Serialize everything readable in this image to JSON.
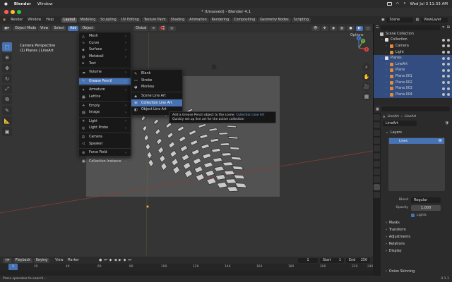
{
  "macos": {
    "app": "Blender",
    "menu": [
      "Window"
    ],
    "datetime": "Wed Jul 3  11:33 AM"
  },
  "window": {
    "title": "* (Unsaved) - Blender 4.1"
  },
  "topbar": {
    "menus": [
      "File",
      "Edit",
      "Render",
      "Window",
      "Help"
    ],
    "workspaces": [
      "Layout",
      "Modeling",
      "Sculpting",
      "UV Editing",
      "Texture Paint",
      "Shading",
      "Animation",
      "Rendering",
      "Compositing",
      "Geometry Nodes",
      "Scripting"
    ],
    "active_workspace": "Layout",
    "scene": "Scene",
    "view_layer": "ViewLayer"
  },
  "viewport": {
    "mode": "Object Mode",
    "menus": [
      "View",
      "Select",
      "Add",
      "Object"
    ],
    "active_menu": "Add",
    "orientation": "Global",
    "options": "Options",
    "overlay_line1": "Camera Perspective",
    "overlay_line2": "(1) Planes | LineArt",
    "axis_labels": {
      "x": "X",
      "y": "Y",
      "z": "Z"
    }
  },
  "add_menu": {
    "items": [
      {
        "label": "Mesh",
        "icon": "mesh-icon",
        "sub": true
      },
      {
        "label": "Curve",
        "icon": "curve-icon",
        "sub": true
      },
      {
        "label": "Surface",
        "icon": "surface-icon",
        "sub": true
      },
      {
        "label": "Metaball",
        "icon": "metaball-icon",
        "sub": true
      },
      {
        "label": "Text",
        "icon": "text-icon",
        "sub": false
      },
      {
        "label": "Volume",
        "icon": "volume-icon",
        "sub": true
      },
      {
        "label": "Grease Pencil",
        "icon": "grease-pencil-icon",
        "sub": true
      },
      {
        "label": "Armature",
        "icon": "armature-icon",
        "sub": true
      },
      {
        "label": "Lattice",
        "icon": "lattice-icon",
        "sub": false
      },
      {
        "label": "Empty",
        "icon": "empty-icon",
        "sub": true
      },
      {
        "label": "Image",
        "icon": "image-icon",
        "sub": true
      },
      {
        "label": "Light",
        "icon": "light-icon",
        "sub": true
      },
      {
        "label": "Light Probe",
        "icon": "light-probe-icon",
        "sub": true
      },
      {
        "label": "Camera",
        "icon": "camera-icon",
        "sub": false
      },
      {
        "label": "Speaker",
        "icon": "speaker-icon",
        "sub": false
      },
      {
        "label": "Force Field",
        "icon": "force-field-icon",
        "sub": true
      },
      {
        "label": "Collection Instance",
        "icon": "collection-instance-icon",
        "sub": true
      }
    ],
    "highlighted": "Grease Pencil"
  },
  "gp_submenu": {
    "items": [
      "Blank",
      "Stroke",
      "Monkey",
      "Scene Line Art",
      "Collection Line Art",
      "Object Line Art"
    ],
    "highlighted": "Collection Line Art"
  },
  "tooltip": {
    "line1_prefix": "Add a Grease Pencil object to the scene:",
    "line1_value": "Collection Line Art",
    "line2": "Quickly set up line art for the active collection"
  },
  "timeline": {
    "menus": [
      "Playback",
      "Keying",
      "View",
      "Marker"
    ],
    "current_frame": "1",
    "start_label": "Start",
    "start": "1",
    "end_label": "End",
    "end": "250",
    "ticks": [
      "1",
      "20",
      "40",
      "60",
      "80",
      "100",
      "120",
      "140",
      "160",
      "180",
      "200",
      "220",
      "240"
    ]
  },
  "status": {
    "left": "Press spacebar to search...",
    "version": "4.1.1"
  },
  "outliner": {
    "search_placeholder": "",
    "rows": [
      {
        "label": "Scene Collection",
        "indent": 0,
        "icon_color": "#bdbdbd",
        "chev": ""
      },
      {
        "label": "Collection",
        "indent": 1,
        "icon_color": "#e0e0e0",
        "chev": "⌄"
      },
      {
        "label": "Camera",
        "indent": 2,
        "icon_color": "#e08a3c",
        "chev": "›"
      },
      {
        "label": "Light",
        "indent": 2,
        "icon_color": "#e08a3c",
        "chev": "›"
      },
      {
        "label": "Planes",
        "indent": 1,
        "icon_color": "#e0e0e0",
        "chev": "⌄"
      },
      {
        "label": "LineArt",
        "indent": 2,
        "icon_color": "#e08a3c",
        "chev": "›"
      },
      {
        "label": "Plane",
        "indent": 2,
        "icon_color": "#e08a3c",
        "chev": "›"
      },
      {
        "label": "Plane.001",
        "indent": 2,
        "icon_color": "#e08a3c",
        "chev": "›"
      },
      {
        "label": "Plane.002",
        "indent": 2,
        "icon_color": "#e08a3c",
        "chev": "›"
      },
      {
        "label": "Plane.003",
        "indent": 2,
        "icon_color": "#e08a3c",
        "chev": "›"
      },
      {
        "label": "Plane.004",
        "indent": 2,
        "icon_color": "#e08a3c",
        "chev": "›"
      }
    ]
  },
  "properties": {
    "breadcrumb_obj": "LineArt",
    "breadcrumb_data": "LineArt",
    "datablock": "LineArt",
    "layers_title": "Layers",
    "layer_name": "Lines",
    "blend_label": "Blend",
    "blend_value": "Regular",
    "opacity_label": "Opacity",
    "opacity_value": "1.000",
    "lights_label": "Lights",
    "sections": [
      "Masks",
      "Transform",
      "Adjustments",
      "Relations",
      "Display"
    ],
    "onion": "Onion Skinning"
  },
  "colors": {
    "accent": "#4772b3",
    "orange": "#e08a3c",
    "green": "#4fa362"
  }
}
